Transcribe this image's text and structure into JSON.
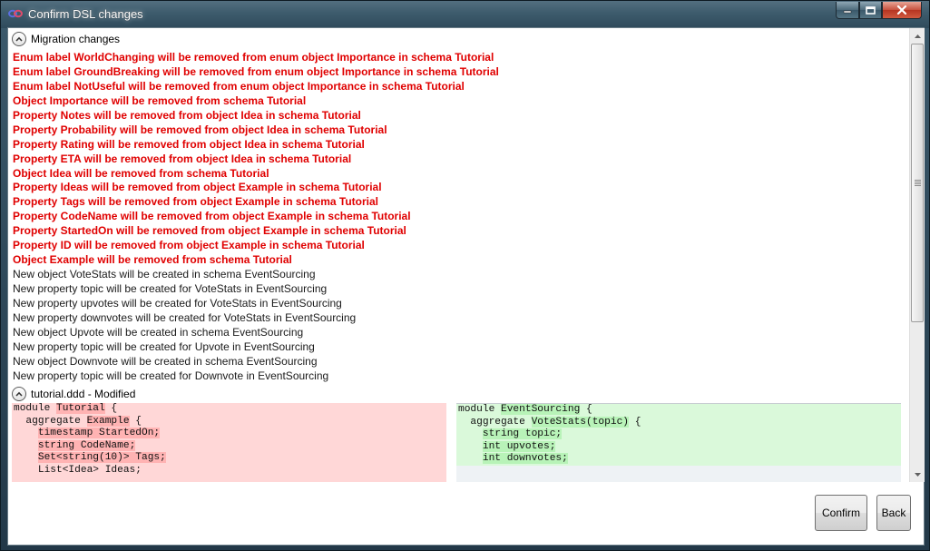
{
  "window": {
    "title": "Confirm DSL changes"
  },
  "migration": {
    "header": "Migration changes",
    "lines": [
      {
        "text": "Enum label WorldChanging will be removed from enum object Importance in schema Tutorial",
        "kind": "removed"
      },
      {
        "text": "Enum label GroundBreaking will be removed from enum object Importance in schema Tutorial",
        "kind": "removed"
      },
      {
        "text": "Enum label NotUseful will be removed from enum object Importance in schema Tutorial",
        "kind": "removed"
      },
      {
        "text": "Object Importance will be removed from schema Tutorial",
        "kind": "removed"
      },
      {
        "text": "Property Notes will be removed from object Idea in schema Tutorial",
        "kind": "removed"
      },
      {
        "text": "Property Probability will be removed from object Idea in schema Tutorial",
        "kind": "removed"
      },
      {
        "text": "Property Rating will be removed from object Idea in schema Tutorial",
        "kind": "removed"
      },
      {
        "text": "Property ETA will be removed from object Idea in schema Tutorial",
        "kind": "removed"
      },
      {
        "text": "Object Idea will be removed from schema Tutorial",
        "kind": "removed"
      },
      {
        "text": "Property Ideas will be removed from object Example in schema Tutorial",
        "kind": "removed"
      },
      {
        "text": "Property Tags will be removed from object Example in schema Tutorial",
        "kind": "removed"
      },
      {
        "text": "Property CodeName will be removed from object Example in schema Tutorial",
        "kind": "removed"
      },
      {
        "text": "Property StartedOn will be removed from object Example in schema Tutorial",
        "kind": "removed"
      },
      {
        "text": "Property ID will be removed from object Example in schema Tutorial",
        "kind": "removed"
      },
      {
        "text": "Object Example will be removed from schema Tutorial",
        "kind": "removed"
      },
      {
        "text": "New object VoteStats will be created in schema EventSourcing",
        "kind": "created"
      },
      {
        "text": "New property topic will be created for VoteStats in EventSourcing",
        "kind": "created"
      },
      {
        "text": "New property upvotes will be created for VoteStats in EventSourcing",
        "kind": "created"
      },
      {
        "text": "New property downvotes will be created for VoteStats in EventSourcing",
        "kind": "created"
      },
      {
        "text": "New object Upvote will be created in schema EventSourcing",
        "kind": "created"
      },
      {
        "text": "New property topic will be created for Upvote in EventSourcing",
        "kind": "created"
      },
      {
        "text": "New object Downvote will be created in schema EventSourcing",
        "kind": "created"
      },
      {
        "text": "New property topic will be created for Downvote in EventSourcing",
        "kind": "created"
      }
    ]
  },
  "file": {
    "header": "tutorial.ddd - Modified",
    "left": [
      [
        [
          "module ",
          ""
        ],
        [
          "Tutorial",
          "hl"
        ],
        [
          " {",
          ""
        ]
      ],
      [
        [
          "  aggregate ",
          ""
        ],
        [
          "Example",
          "hl"
        ],
        [
          " {",
          ""
        ]
      ],
      [
        [
          "    ",
          ""
        ],
        [
          "timestamp StartedOn;",
          "hl"
        ]
      ],
      [
        [
          "    ",
          ""
        ],
        [
          "string CodeName;",
          "hl"
        ]
      ],
      [
        [
          "    ",
          ""
        ],
        [
          "Set<string(10)> Tags;",
          "hl"
        ]
      ],
      [
        [
          "    List<Idea> Ideas;",
          ""
        ]
      ]
    ],
    "right": [
      [
        [
          "module ",
          ""
        ],
        [
          "EventSourcing",
          "hl"
        ],
        [
          " {",
          ""
        ]
      ],
      [
        [
          "  aggregate ",
          ""
        ],
        [
          "VoteStats(topic)",
          "hl"
        ],
        [
          " {",
          ""
        ]
      ],
      [
        [
          "    ",
          ""
        ],
        [
          "string topic;",
          "hl"
        ]
      ],
      [
        [
          "    ",
          ""
        ],
        [
          "int upvotes;",
          "hl"
        ]
      ],
      [
        [
          "    ",
          ""
        ],
        [
          "int downvotes;",
          "hl"
        ]
      ]
    ]
  },
  "buttons": {
    "confirm": "Confirm",
    "back": "Back"
  },
  "colors": {
    "removed": "#e00000",
    "diff_removed_bg": "#ffd7d7",
    "diff_added_bg": "#daf9da"
  },
  "icons": {
    "app": "infinity-icon",
    "collapse": "chevron-up-icon",
    "minimize": "minimize-icon",
    "maximize": "maximize-icon",
    "close": "close-icon"
  }
}
